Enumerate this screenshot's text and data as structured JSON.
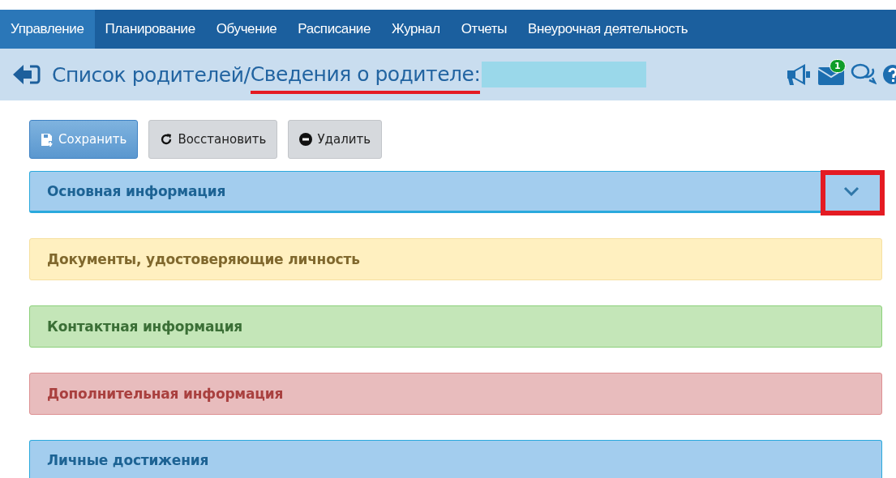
{
  "nav": {
    "items": [
      {
        "label": "Управление",
        "selected": true
      },
      {
        "label": "Планирование",
        "selected": false
      },
      {
        "label": "Обучение",
        "selected": false
      },
      {
        "label": "Расписание",
        "selected": false
      },
      {
        "label": "Журнал",
        "selected": false
      },
      {
        "label": "Отчеты",
        "selected": false
      },
      {
        "label": "Внеурочная деятельность",
        "selected": false
      }
    ]
  },
  "header": {
    "breadcrumb": "Список родителей",
    "separator": "/",
    "title": "Сведения о родителе:",
    "title_underlined": true,
    "name_redacted": true,
    "mail_badge": "1"
  },
  "buttons": [
    {
      "label": "Сохранить",
      "kind": "primary"
    },
    {
      "label": "Восстановить",
      "kind": "restore"
    },
    {
      "label": "Удалить",
      "kind": "delete"
    }
  ],
  "panels": [
    {
      "title": "Основная информация",
      "kind": "info",
      "toggle": true,
      "highlighted": true
    },
    {
      "title": "Документы, удостоверяющие личность",
      "kind": "warning",
      "toggle": false,
      "highlighted": false
    },
    {
      "title": "Контактная информация",
      "kind": "success",
      "toggle": false,
      "highlighted": false
    },
    {
      "title": "Дополнительная информация",
      "kind": "danger",
      "toggle": false,
      "highlighted": false
    },
    {
      "title": "Личные достижения",
      "kind": "info",
      "toggle": false,
      "highlighted": false
    }
  ]
}
